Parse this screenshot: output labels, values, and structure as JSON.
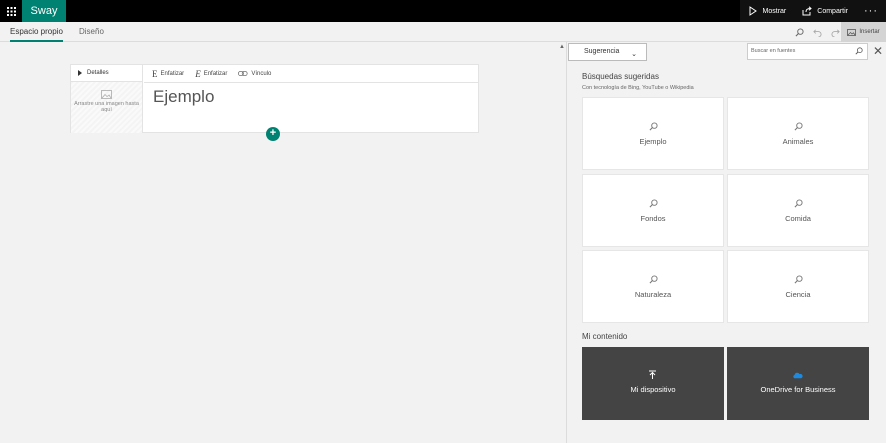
{
  "app": {
    "brand": "Sway"
  },
  "top_actions": {
    "show": "Mostrar",
    "share": "Compartir",
    "more": "···"
  },
  "tabs": [
    {
      "label": "Espacio propio"
    },
    {
      "label": "Diseño"
    }
  ],
  "toolbar": {
    "insert": "Insertar"
  },
  "card": {
    "details": "Detalles",
    "dropzone": "Arrastre una imagen hasta aquí",
    "tools": [
      "Enfatizar",
      "Enfatizar",
      "Vínculo"
    ],
    "title": "Ejemplo"
  },
  "pane": {
    "dropdown": "Sugerencia",
    "search_placeholder": "Buscar en fuentes",
    "suggested_title": "Búsquedas sugeridas",
    "suggested_sub": "Con tecnología de Bing, YouTube o Wikipedia",
    "suggestions": [
      "Ejemplo",
      "Animales",
      "Fondos",
      "Comida",
      "Naturaleza",
      "Ciencia"
    ],
    "my_content_title": "Mi contenido",
    "my_content": [
      "Mi dispositivo",
      "OneDrive for Business"
    ]
  },
  "colors": {
    "accent": "#008272",
    "topbar": "#000000",
    "dark_tile": "#444444"
  },
  "icons": [
    "waffle-icon",
    "play-icon",
    "share-icon",
    "search-icon",
    "undo-icon",
    "redo-icon",
    "image-icon",
    "link-icon",
    "upload-icon",
    "onedrive-icon",
    "close-icon",
    "plus-icon"
  ]
}
